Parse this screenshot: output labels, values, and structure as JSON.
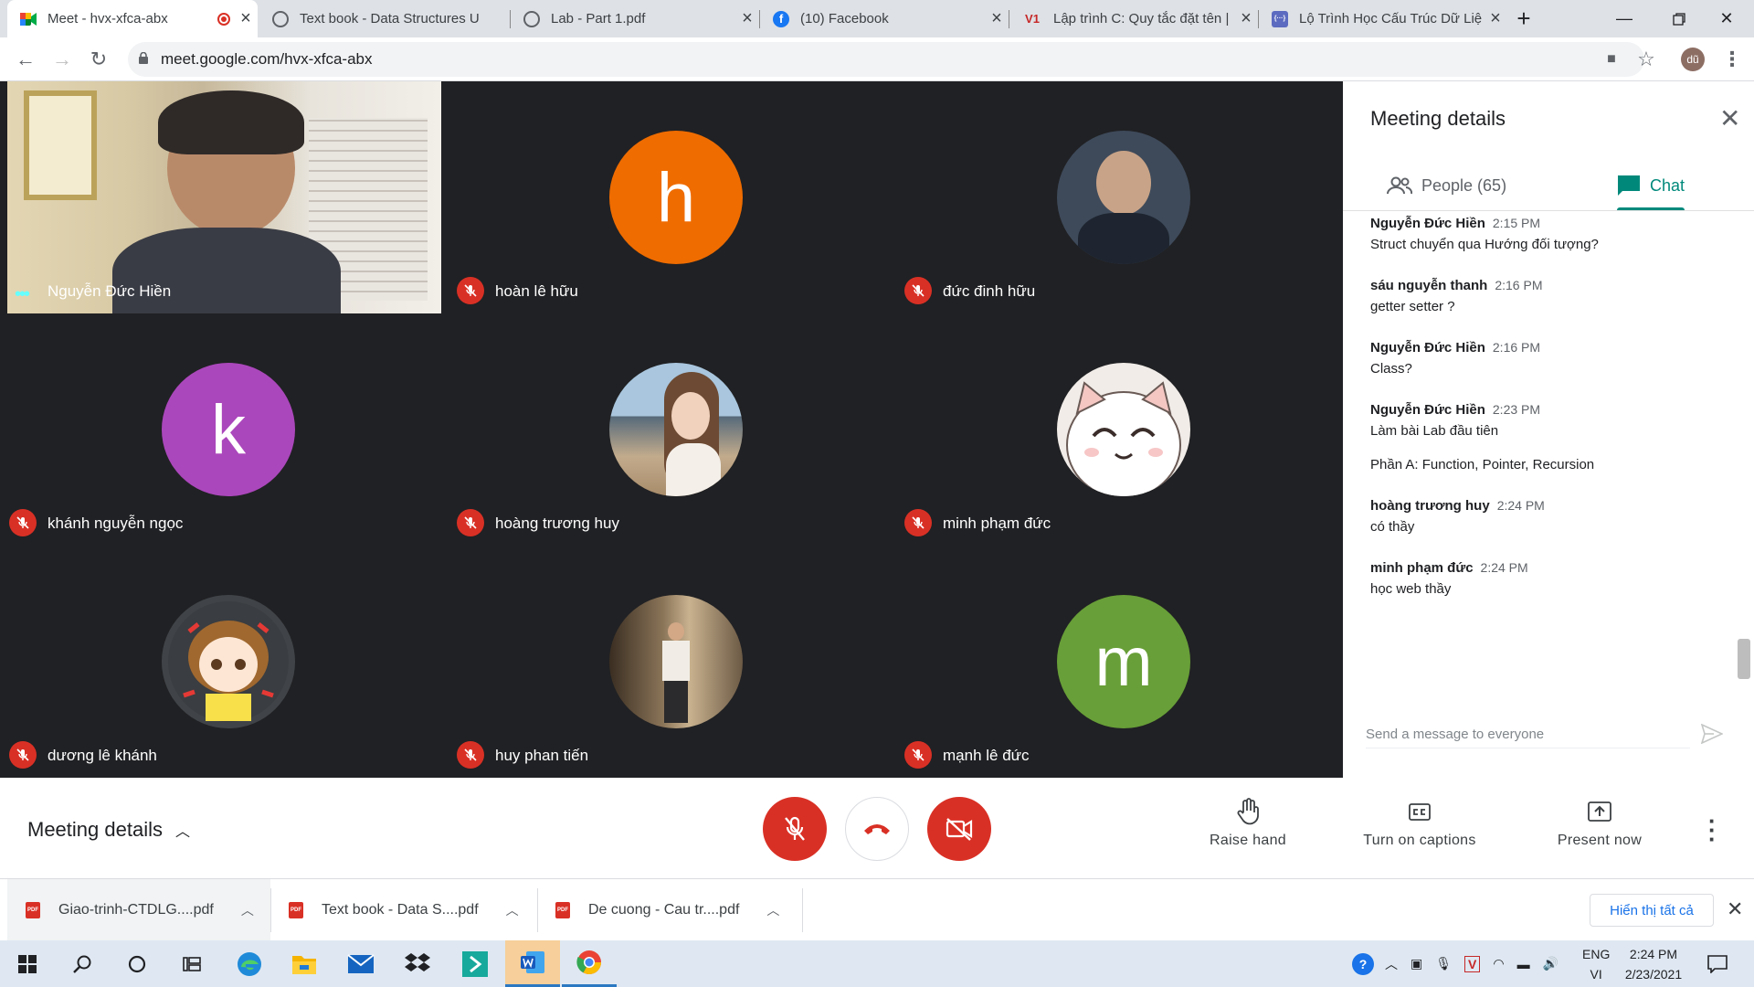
{
  "browser": {
    "tabs": [
      {
        "title": "Meet - hvx-xfca-abx",
        "active": true,
        "icon": "meet-icon"
      },
      {
        "title": "Text book - Data Structures U",
        "active": false,
        "icon": "globe-icon"
      },
      {
        "title": "Lab - Part 1.pdf",
        "active": false,
        "icon": "globe-icon"
      },
      {
        "title": "(10) Facebook",
        "active": false,
        "icon": "facebook-icon"
      },
      {
        "title": "Lập trình C: Quy tắc đặt tên |",
        "active": false,
        "icon": "v1-icon"
      },
      {
        "title": "Lộ Trình Học Cấu Trúc Dữ Liệ",
        "active": false,
        "icon": "braces-icon"
      }
    ],
    "fav_v1": "V1",
    "fav_braces": "{···}",
    "url": "meet.google.com/hvx-xfca-abx",
    "profile": "dũ"
  },
  "participants": [
    {
      "name": "Nguyễn Đức Hiền",
      "type": "video"
    },
    {
      "name": "hoàn lê hữu",
      "initial": "h",
      "color": "#ef6c00",
      "muted": true
    },
    {
      "name": "đức đinh hữu",
      "type": "photo",
      "color": "#3e4a5a",
      "muted": true
    },
    {
      "name": "khánh nguyễn ngọc",
      "initial": "k",
      "color": "#ab47bc",
      "muted": true
    },
    {
      "name": "hoàng trương huy",
      "type": "photo",
      "color": "#b39a7e",
      "muted": true
    },
    {
      "name": "minh phạm đức",
      "type": "photo",
      "color": "#f1ece8",
      "muted": true
    },
    {
      "name": "dương lê khánh",
      "type": "photo",
      "color": "#404448",
      "muted": true
    },
    {
      "name": "huy phan tiến",
      "type": "photo",
      "color": "#6e5a44",
      "muted": true
    },
    {
      "name": "mạnh lê đức",
      "initial": "m",
      "color": "#689f38",
      "muted": true
    }
  ],
  "panel": {
    "title": "Meeting details",
    "people_tab": "People (65)",
    "chat_tab": "Chat",
    "messages": [
      {
        "sender": "Nguyễn Đức Hiền",
        "time": "2:15 PM",
        "lines": [
          "Struct chuyển qua Hướng đối tượng?"
        ]
      },
      {
        "sender": "sáu nguyễn thanh",
        "time": "2:16 PM",
        "lines": [
          "getter setter ?"
        ]
      },
      {
        "sender": "Nguyễn Đức Hiền",
        "time": "2:16 PM",
        "lines": [
          "Class?"
        ]
      },
      {
        "sender": "Nguyễn Đức Hiền",
        "time": "2:23 PM",
        "lines": [
          "Làm bài Lab đầu tiên",
          "Phần A: Function, Pointer, Recursion"
        ]
      },
      {
        "sender": "hoàng trương huy",
        "time": "2:24 PM",
        "lines": [
          "có thầy"
        ]
      },
      {
        "sender": "minh phạm đức",
        "time": "2:24 PM",
        "lines": [
          "học web thầy"
        ]
      }
    ],
    "send_placeholder": "Send a message to everyone"
  },
  "controls": {
    "meeting_details": "Meeting details",
    "raise_hand": "Raise hand",
    "captions": "Turn on captions",
    "present": "Present now"
  },
  "downloads": {
    "items": [
      "Giao-trinh-CTDLG....pdf",
      "Text book - Data S....pdf",
      "De cuong - Cau tr....pdf"
    ],
    "pdf_badge": "PDF",
    "show_all": "Hiển thị tất cả"
  },
  "taskbar": {
    "lang_top": "ENG",
    "lang_bottom": "VI",
    "time": "2:24 PM",
    "date": "2/23/2021"
  },
  "colors": {
    "red": "#d93025",
    "teal": "#00897b",
    "chrome_tab_bg": "#dee1e6"
  }
}
